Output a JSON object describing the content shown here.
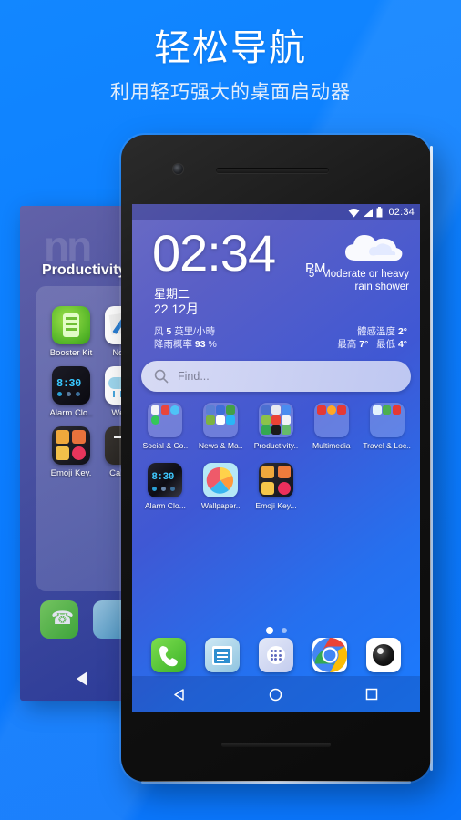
{
  "headline": {
    "title": "轻松导航",
    "subtitle": "利用轻巧强大的桌面启动器"
  },
  "colors": {
    "background": "#0b7fff",
    "wallpaper_start": "#6a6bc4",
    "wallpaper_end": "#1a7bff",
    "accent_white": "#ffffff"
  },
  "phone": {
    "statusbar": {
      "time": "02:34",
      "icons": [
        "wifi-icon",
        "signal-icon",
        "battery-icon"
      ]
    },
    "clock_widget": {
      "time": "02:34",
      "ampm": "PM",
      "weekday": "星期二",
      "date": "22 12月",
      "weather_icon": "cloud-rain-icon",
      "temperature": "5°",
      "condition": "Moderate or heavy rain shower",
      "wind_label": "风",
      "wind_value": "5",
      "wind_unit": "英里/小時",
      "rain_label": "降雨概率",
      "rain_value": "93",
      "rain_unit": "%",
      "feels_label": "體感溫度",
      "feels_value": "2",
      "feels_unit": "°",
      "high_label": "最高",
      "high_value": "7",
      "high_unit": "°",
      "low_label": "最低",
      "low_value": "4",
      "low_unit": "°"
    },
    "search": {
      "placeholder": "Find...",
      "icon": "search-icon"
    },
    "app_grid": {
      "row1": [
        {
          "label": "Social & Co..",
          "type": "folder",
          "minis": [
            "#f4f4f6",
            "#e8453c",
            "#4fc3f7",
            "#34c759",
            "transparent",
            "transparent",
            "transparent",
            "transparent",
            "transparent"
          ]
        },
        {
          "label": "News & Ma..",
          "type": "folder",
          "minis": [
            "#5b7fd4",
            "#3f6fd8",
            "#43a047",
            "#7cb342",
            "#ffffff",
            "#29b6f6",
            "transparent",
            "transparent",
            "transparent"
          ]
        },
        {
          "label": "Productivity..",
          "type": "folder",
          "minis": [
            "#4b6fd0",
            "#e8eaf0",
            "#4a8df0",
            "#8bc34a",
            "#ea4335",
            "#f1f3f6",
            "#34a853",
            "#1b1b1b",
            "#66bb6a"
          ]
        },
        {
          "label": "Multimedia",
          "type": "folder",
          "minis": [
            "#e53935",
            "#ffa726",
            "#e53935",
            "transparent",
            "transparent",
            "transparent",
            "transparent",
            "transparent",
            "transparent"
          ]
        },
        {
          "label": "Travel & Loc..",
          "type": "folder",
          "minis": [
            "#e3f2fd",
            "#4caf50",
            "#e53935",
            "transparent",
            "transparent",
            "transparent",
            "transparent",
            "transparent",
            "transparent"
          ]
        }
      ],
      "row2": [
        {
          "label": "Alarm Clo...",
          "type": "app",
          "icon": "alarm-clock-icon",
          "digits": "8:30"
        },
        {
          "label": "Wallpaper..",
          "type": "app",
          "icon": "wallpaper-icon"
        },
        {
          "label": "Emoji Key...",
          "type": "app",
          "icon": "emoji-keyboard-icon"
        }
      ]
    },
    "page_dots": {
      "count": 2,
      "active_index": 0
    },
    "dock": [
      {
        "label": "Phone",
        "icon": "phone-icon"
      },
      {
        "label": "Messages",
        "icon": "messages-icon"
      },
      {
        "label": "App Drawer",
        "icon": "app-drawer-icon"
      },
      {
        "label": "Chrome",
        "icon": "chrome-icon"
      },
      {
        "label": "Camera",
        "icon": "camera-icon"
      }
    ],
    "navbar": [
      {
        "label": "Back",
        "icon": "back-triangle-icon"
      },
      {
        "label": "Home",
        "icon": "home-circle-icon"
      },
      {
        "label": "Recents",
        "icon": "recents-square-icon"
      }
    ]
  },
  "background_panel": {
    "folder_title": "Productivity",
    "apps": [
      {
        "label": "Booster Kit",
        "icon": "booster-kit-icon"
      },
      {
        "label": "Notep",
        "icon": "notepad-icon"
      },
      {
        "label": "Alarm Clo..",
        "icon": "alarm-clock-icon",
        "digits": "8:30"
      },
      {
        "label": "Weath",
        "icon": "weather-icon"
      },
      {
        "label": "Emoji Key.",
        "icon": "emoji-keyboard-icon"
      },
      {
        "label": "Calcula",
        "icon": "calculator-icon"
      }
    ],
    "dock": [
      {
        "label": "Phone",
        "icon": "phone-icon"
      },
      {
        "label": "Messages",
        "icon": "messages-icon"
      }
    ],
    "navbar": [
      {
        "label": "Back",
        "icon": "back-triangle-icon"
      }
    ]
  }
}
